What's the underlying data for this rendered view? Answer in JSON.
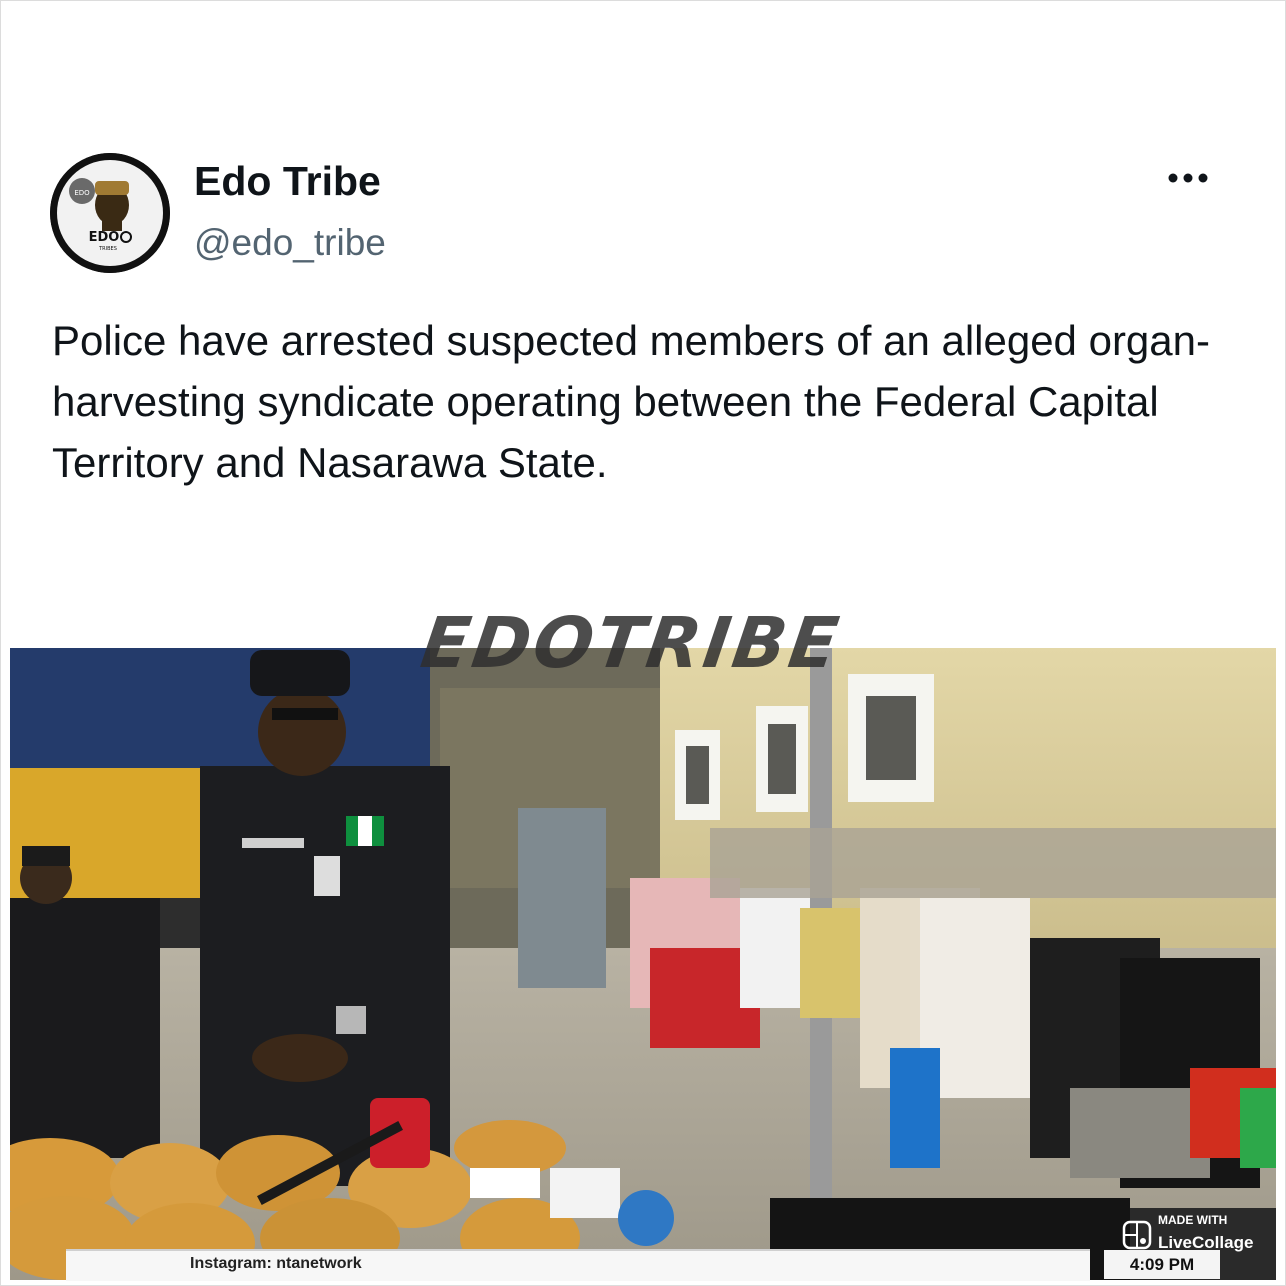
{
  "author": {
    "display_name": "Edo Tribe",
    "handle": "@edo_tribe",
    "avatar_lettering": "EDO",
    "avatar_sub_lettering": "TRIBES"
  },
  "menu": {
    "more_icon": "more-horizontal-icon"
  },
  "tweet": {
    "text": "Police have arrested suspected members of an alleged organ-harvesting syndicate operating between the Federal Capital Territory and Nasarawa State."
  },
  "media": {
    "watermark": "EDOTRIBE",
    "ticker_text": "Instagram: ntanetwork",
    "clock": "4:09 PM",
    "made_with": "MADE WITH",
    "app_name": "LiveCollage"
  },
  "colors": {
    "text_primary": "#0f1419",
    "text_secondary": "#536471"
  }
}
